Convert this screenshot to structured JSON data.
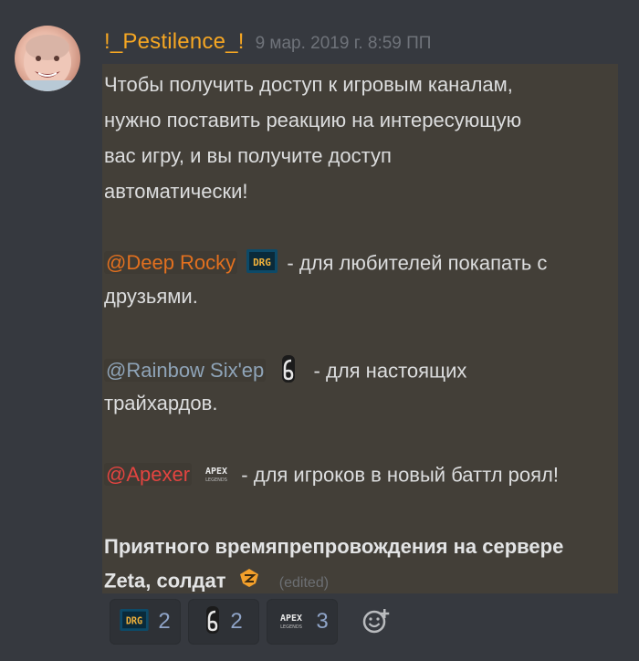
{
  "message": {
    "author": "!_Pestilence_!",
    "timestamp": "9 мар. 2019 г. 8:59 ПП",
    "lines": [
      "Чтобы получить доступ к игровым каналам,",
      "нужно поставить реакцию на интересующую",
      "вас игру, и вы получите доступ",
      "автоматически!"
    ],
    "roles": [
      {
        "mention": "@Deep Rocky",
        "emoji": "DRG",
        "text": "- для любителей покапать с",
        "continuation": "друзьями."
      },
      {
        "mention": "@Rainbow Six'ep",
        "emoji": "6",
        "text": "- для настоящих",
        "continuation": "трайхардов."
      },
      {
        "mention": "@Apexer",
        "emoji": "APEX",
        "text": "- для игроков в новый  баттл роял!"
      }
    ],
    "closing_line1": "Приятного времяпрепровождения на сервере",
    "closing_line2": "Zeta, солдат",
    "closing_emoji": "ZETA",
    "edited_label": "(edited)"
  },
  "reactions": [
    {
      "emoji": "DRG",
      "count": "2"
    },
    {
      "emoji": "6",
      "count": "2"
    },
    {
      "emoji": "APEX",
      "count": "3"
    }
  ],
  "colors": {
    "background": "#36393f",
    "username": "#f5a623",
    "mention_orange": "#e2701f",
    "mention_blue": "#8fa4b8",
    "mention_red": "#e34440"
  },
  "icons": {
    "add_reaction": "add-reaction-icon"
  }
}
